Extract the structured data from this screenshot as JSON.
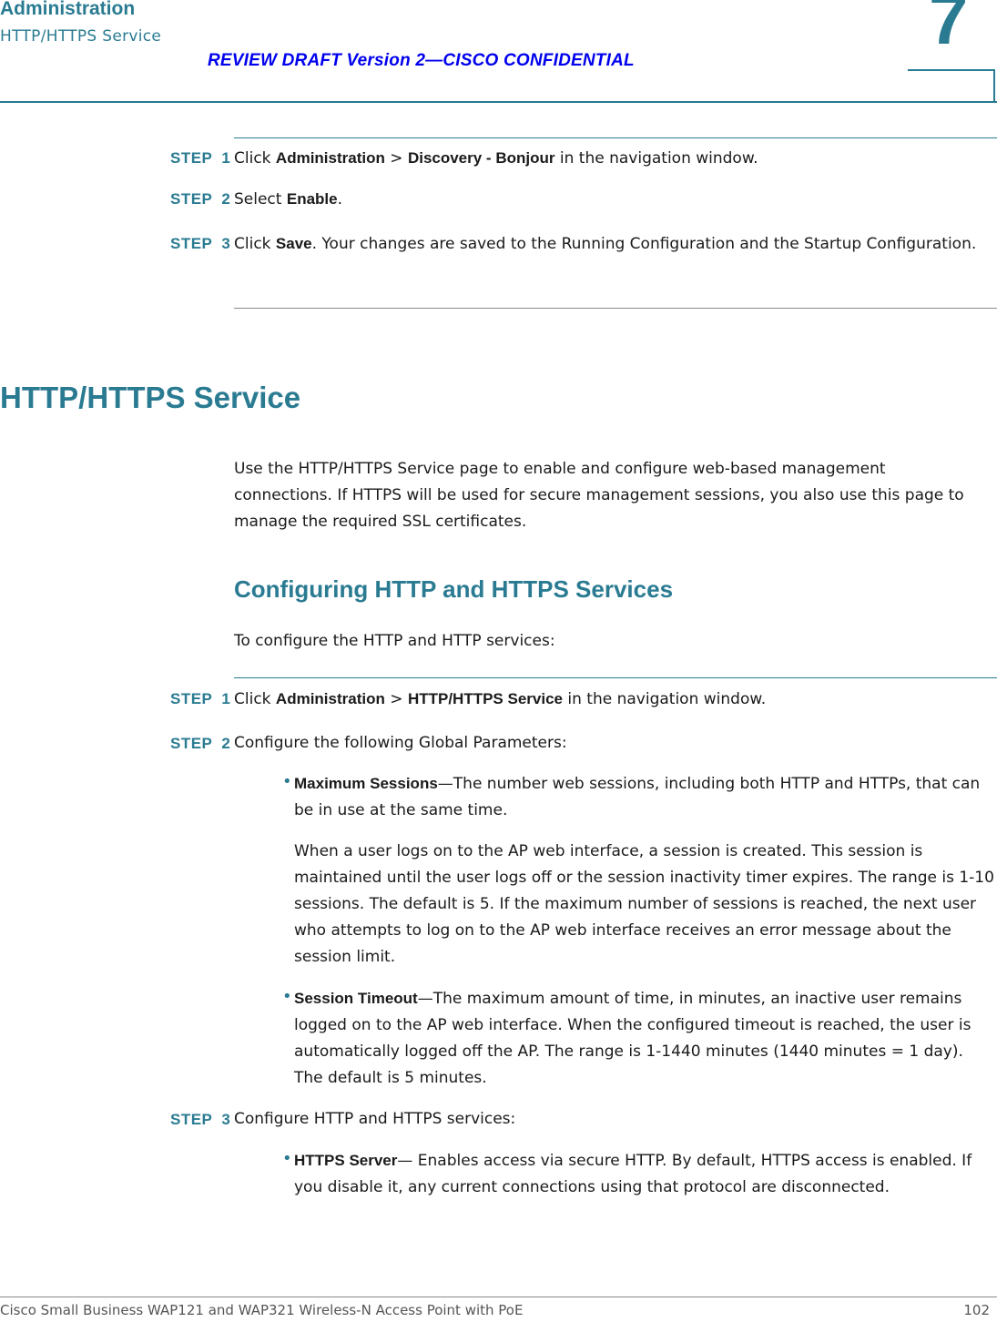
{
  "header": {
    "chapter_title": "Administration",
    "section_subtitle": "HTTP/HTTPS Service",
    "draft_notice": "REVIEW DRAFT  Version 2—CISCO CONFIDENTIAL",
    "chapter_number": "7"
  },
  "step_word": "STEP",
  "procedure_bonjour": {
    "steps": [
      {
        "num": "1",
        "pre": "Click ",
        "b1": "Administration",
        "mid": " > ",
        "b2": "Discovery - Bonjour",
        "post": " in the navigation window."
      },
      {
        "num": "2",
        "pre": "Select ",
        "b1": "Enable",
        "post": "."
      },
      {
        "num": "3",
        "pre": "Click ",
        "b1": "Save",
        "post": ". Your changes are saved to the Running Configuration and the Startup Configuration."
      }
    ]
  },
  "section": {
    "title": "HTTP/HTTPS Service",
    "intro": "Use the HTTP/HTTPS Service page to enable and configure web-based management connections. If HTTPS will be used for secure management sessions, you also use this page to manage the required SSL certificates.",
    "subsection_title": "Configuring HTTP and HTTPS Services",
    "subsection_intro": "To configure the HTTP and HTTP services:"
  },
  "procedure_http": {
    "step1": {
      "num": "1",
      "pre": "Click ",
      "b1": "Administration",
      "mid": " > ",
      "b2": "HTTP/HTTPS Service",
      "post": " in the navigation window."
    },
    "step2": {
      "num": "2",
      "text": "Configure the following Global Parameters:"
    },
    "step2_bullets": [
      {
        "term": "Maximum Sessions",
        "desc": "—The number web sessions, including both HTTP and HTTPs, that can be in use at the same time."
      },
      {
        "term": "Session Timeout",
        "desc": "—The maximum amount of time, in minutes, an inactive user remains logged on to the AP web interface. When the configured timeout is reached, the user is automatically logged off the AP. The range is 1-1440 minutes (1440 minutes = 1 day). The default is 5 minutes."
      }
    ],
    "max_sessions_extra": "When a user logs on to the AP web interface, a session is created. This session is maintained until the user logs off or the session inactivity timer expires. The range is 1-10 sessions. The default is 5. If the maximum number of sessions is reached, the next user who attempts to log on to the AP web interface receives an error message about the session limit.",
    "step3": {
      "num": "3",
      "text": "Configure HTTP and HTTPS services:"
    },
    "step3_bullets": [
      {
        "term": "HTTPS Server",
        "desc": "— Enables access via secure HTTP. By default, HTTPS access is enabled. If you disable it, any current connections using that protocol are disconnected."
      }
    ]
  },
  "bullet_glyph": "•",
  "footer": {
    "product": "Cisco Small Business WAP121 and WAP321 Wireless-N Access Point with PoE",
    "page_number": "102"
  }
}
